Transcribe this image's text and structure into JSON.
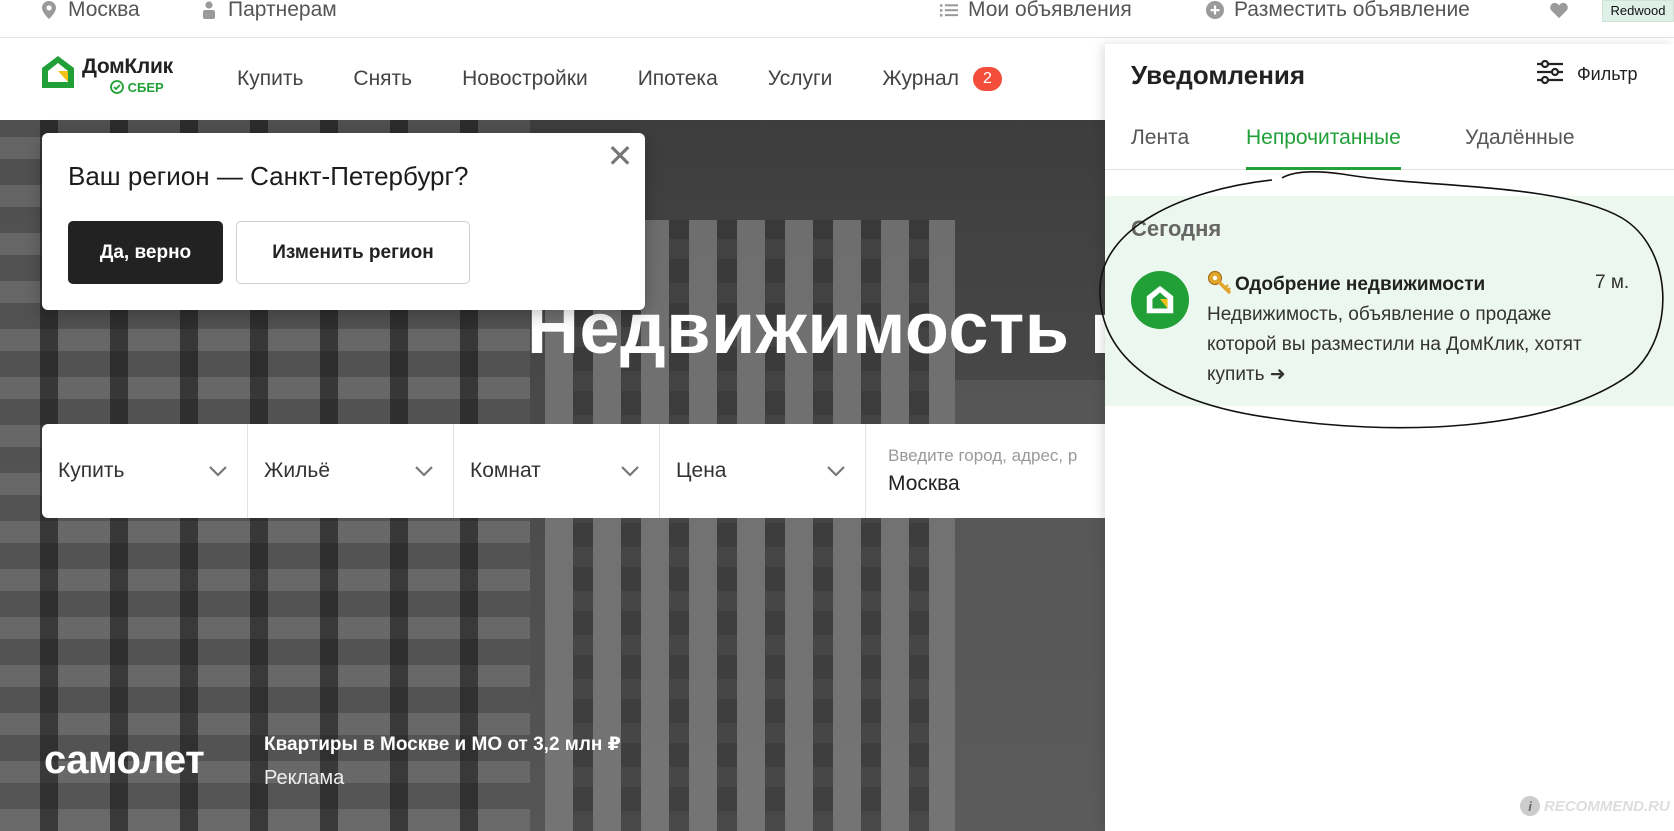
{
  "topbar": {
    "city": "Москва",
    "partners": "Партнерам",
    "my_ads": "Мои объявления",
    "post_ad": "Разместить объявление",
    "redwood": "Redwood"
  },
  "header": {
    "logo_name": "ДомКлик",
    "logo_sber": "СБЕР",
    "nav": [
      {
        "label": "Купить"
      },
      {
        "label": "Снять"
      },
      {
        "label": "Новостройки"
      },
      {
        "label": "Ипотека"
      },
      {
        "label": "Услуги"
      },
      {
        "label": "Журнал",
        "badge": "2"
      }
    ]
  },
  "hero": {
    "title": "Недвижимость в"
  },
  "region_popup": {
    "question": "Ваш регион — Санкт-Петербург?",
    "yes_label": "Да, верно",
    "change_label": "Изменить регион",
    "close_glyph": "✕"
  },
  "search": {
    "deal_type": "Купить",
    "property": "Жильё",
    "rooms": "Комнат",
    "price": "Цена",
    "address_placeholder": "Введите город, адрес, р",
    "address_value": "Москва"
  },
  "ad": {
    "brand": "самолет",
    "text": "Квартиры в Москве и МО от 3,2 млн ₽",
    "label": "Реклама"
  },
  "notifications": {
    "title": "Уведомления",
    "filter_label": "Фильтр",
    "tabs": [
      {
        "label": "Лента"
      },
      {
        "label": "Непрочитанные",
        "active": true
      },
      {
        "label": "Удалённые"
      }
    ],
    "group_label": "Сегодня",
    "item": {
      "icon": "key-icon",
      "title": "Одобрение недвижимости",
      "time": "7 м.",
      "body": "Недвижимость, объявление о продаже которой вы разместили на ДомКлик, хотят купить ➜"
    }
  },
  "watermark": "RECOMMEND.RU",
  "colors": {
    "brand_green": "#21a038",
    "badge_red": "#f24e3b",
    "dark_button": "#222222",
    "notification_bg": "#ecf7ef"
  }
}
